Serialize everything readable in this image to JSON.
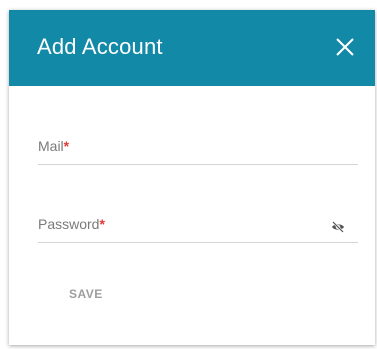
{
  "dialog": {
    "title": "Add Account",
    "close_icon": "close-icon"
  },
  "fields": {
    "mail": {
      "label": "Mail",
      "required_mark": "*",
      "value": ""
    },
    "password": {
      "label": "Password",
      "required_mark": "*",
      "value": "",
      "toggle_icon": "eye-off-icon"
    }
  },
  "actions": {
    "save_label": "SAVE"
  },
  "colors": {
    "header_background": "#1289a7",
    "required_mark": "#e53935",
    "label_text": "#7a7a7a",
    "save_text": "#9e9e9e"
  }
}
